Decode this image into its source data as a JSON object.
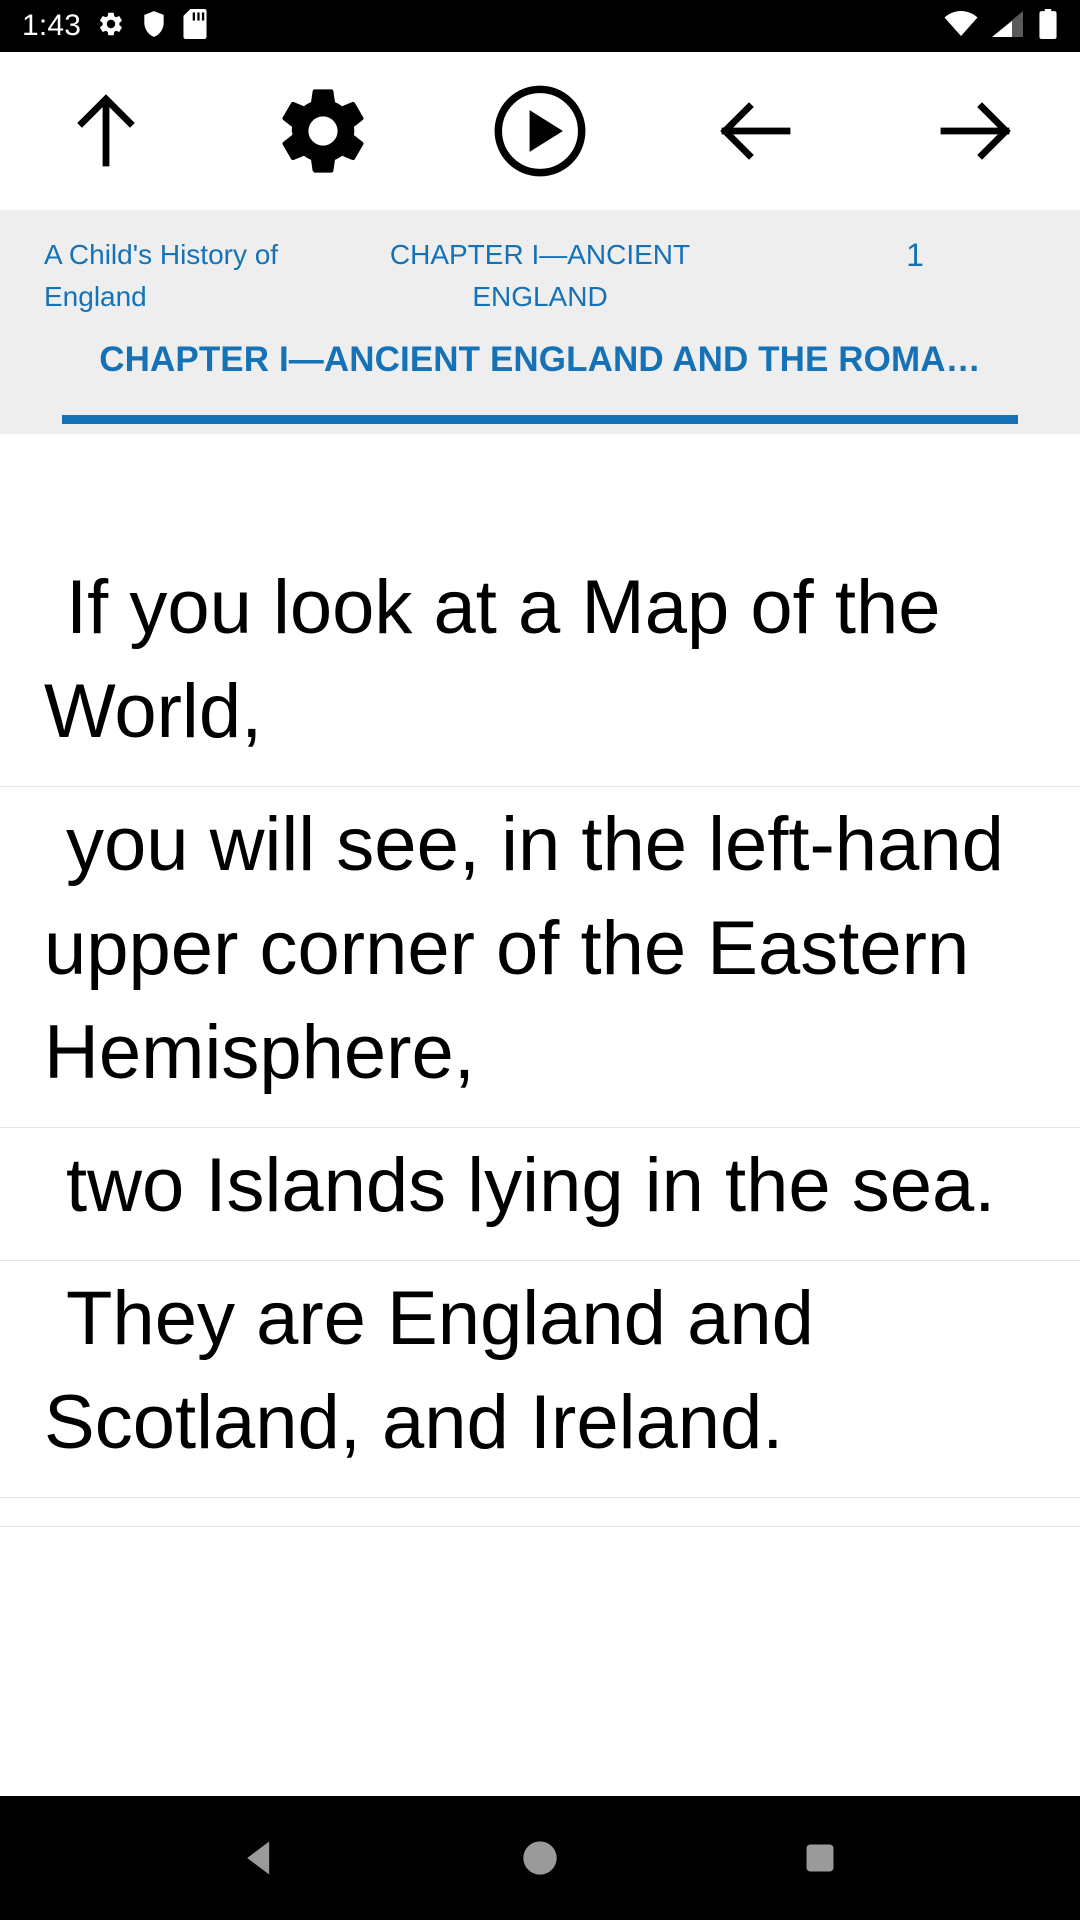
{
  "status_bar": {
    "time": "1:43",
    "icons": [
      "gear-icon",
      "shield-icon",
      "sdcard-icon"
    ],
    "right_icons": [
      "wifi-icon",
      "cellular-signal-icon",
      "battery-icon"
    ],
    "background": "#000000",
    "foreground": "#ffffff"
  },
  "toolbar": {
    "buttons": [
      {
        "name": "up-arrow-icon",
        "label": "Up"
      },
      {
        "name": "settings-gear-icon",
        "label": "Settings"
      },
      {
        "name": "play-circle-icon",
        "label": "Play"
      },
      {
        "name": "left-arrow-icon",
        "label": "Previous"
      },
      {
        "name": "right-arrow-icon",
        "label": "Next"
      }
    ]
  },
  "tabs": {
    "accent_color": "#1572b6",
    "background": "#eeeeee",
    "breadcrumb": [
      {
        "label": "A Child's History of England"
      },
      {
        "label": "CHAPTER I—ANCIENT ENGLAND"
      },
      {
        "label": "1"
      }
    ],
    "selected": {
      "label": "CHAPTER I—ANCIENT ENGLAND AND THE ROMA…"
    }
  },
  "content": {
    "paragraphs": [
      {
        "text": "If you look at a Map of the World,"
      },
      {
        "text": "you will see, in the left-hand upper corner of the Eastern Hemisphere,"
      },
      {
        "text": "two Islands lying in the sea."
      },
      {
        "text": "They are England and Scotland, and Ireland."
      },
      {
        "text": ""
      }
    ]
  },
  "nav_bar": {
    "background": "#000000",
    "icon_color": "#9a9a9a",
    "buttons": [
      {
        "name": "android-back-button",
        "label": "Back"
      },
      {
        "name": "android-home-button",
        "label": "Home"
      },
      {
        "name": "android-recents-button",
        "label": "Recents"
      }
    ]
  }
}
